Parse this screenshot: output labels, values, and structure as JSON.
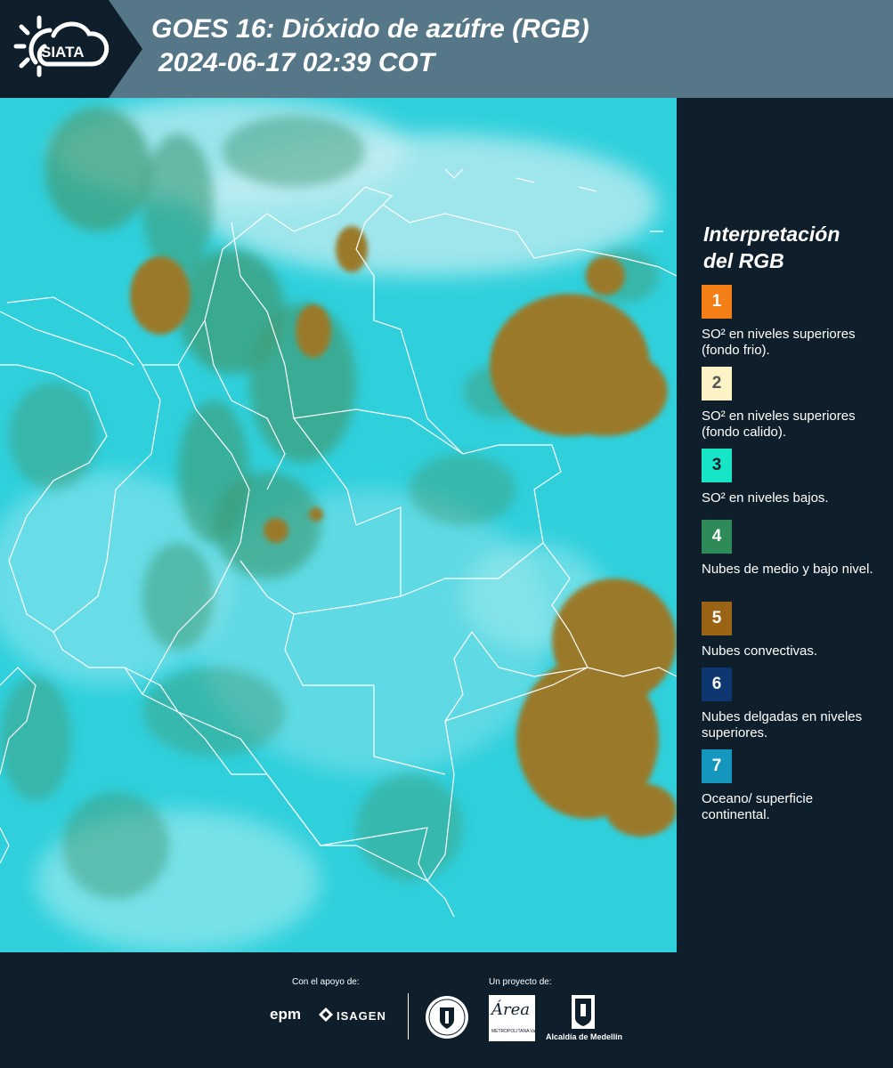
{
  "header": {
    "brand": "SIATA",
    "title_line1": "GOES 16: Dióxido de azúfre (RGB)",
    "title_line2": "2024-06-17 02:39 COT"
  },
  "legend": {
    "title_line1": "Interpretación",
    "title_line2": "del RGB",
    "items": [
      {
        "number": "1",
        "label": "SO² en niveles superiores (fondo frio).",
        "color": "#f47f17",
        "text_color": "#ffffff"
      },
      {
        "number": "2",
        "label": "SO² en niveles superiores (fondo calido).",
        "color": "#fbf3c5",
        "text_color": "#555555"
      },
      {
        "number": "3",
        "label": "SO² en niveles bajos.",
        "color": "#16e6c7",
        "text_color": "#0e1f2b"
      },
      {
        "number": "4",
        "label": "Nubes de medio y bajo nivel.",
        "color": "#2e8a57",
        "text_color": "#ffffff"
      },
      {
        "number": "5",
        "label": "Nubes convectivas.",
        "color": "#9a6414",
        "text_color": "#ffffff"
      },
      {
        "number": "6",
        "label": "Nubes delgadas en niveles superiores.",
        "color": "#0e3770",
        "text_color": "#ffffff"
      },
      {
        "number": "7",
        "label": "Oceano/ superficie continental.",
        "color": "#1596bd",
        "text_color": "#ffffff"
      }
    ]
  },
  "footer": {
    "support_label": "Con el apoyo de:",
    "project_label": "Un proyecto de:",
    "sponsors": [
      "epm",
      "ISAGEN"
    ],
    "partners": [
      "Área Metropolitana Valle de Aburrá",
      "Alcaldía de Medellín"
    ],
    "alcaldia_text": "Alcaldía de Medellín",
    "area_text": "Área",
    "area_sub": "METROPOLITANA Valle de Aburrá"
  },
  "map": {
    "ocean_color": "#2fd0dc",
    "cloud_color": "#9a7a2a",
    "land_color": "#3f9c78"
  }
}
